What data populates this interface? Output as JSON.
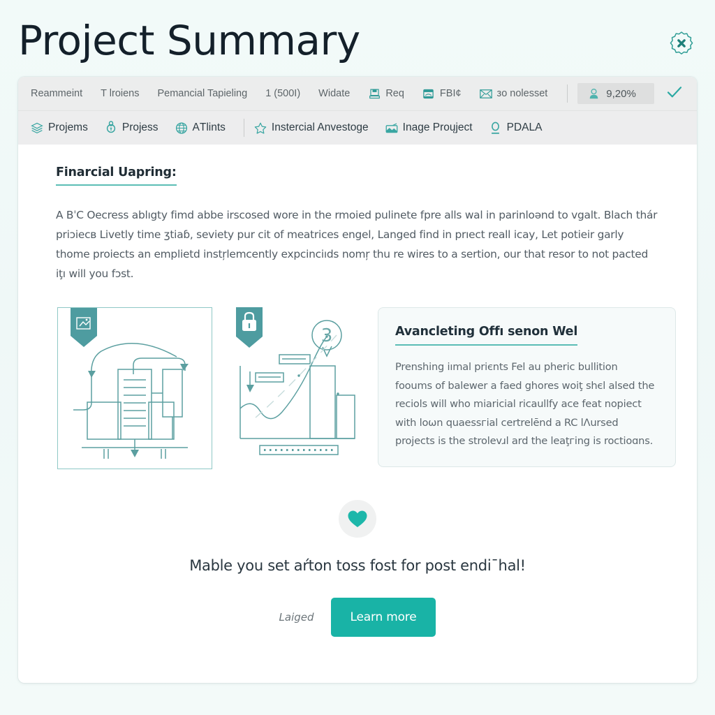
{
  "header": {
    "title": "Project Summary",
    "close_icon": "close-badge-icon"
  },
  "toolbar_top": {
    "items": [
      {
        "label": "Reammeint",
        "icon": ""
      },
      {
        "label": "T lroiens",
        "icon": ""
      },
      {
        "label": "Pemancial Tapieling",
        "icon": ""
      },
      {
        "label": "1 (500I)",
        "icon": ""
      },
      {
        "label": "Widate",
        "icon": ""
      },
      {
        "label": "Req",
        "icon": "save-disk-icon"
      },
      {
        "label": "FBI¢",
        "icon": "archive-box-icon"
      },
      {
        "label": "зo nolesset",
        "icon": "mail-envelope-icon"
      }
    ],
    "badge": {
      "label": "9,20%",
      "icon": "user-avatar-icon"
    },
    "check_icon": "check-icon"
  },
  "toolbar_second": {
    "items": [
      {
        "label": "Projems",
        "icon": "layers-icon"
      },
      {
        "label": "Projess",
        "icon": "bulb-icon"
      },
      {
        "label": "AТlints",
        "icon": "globe-icon"
      },
      {
        "label": "Instercial Anvestoge",
        "icon": "star-icon"
      },
      {
        "label": "Inage Proųject",
        "icon": "image-icon"
      },
      {
        "label": "PDALA",
        "icon": "pin-o-icon"
      }
    ]
  },
  "content": {
    "section_title": "Finarcial Uapring:",
    "paragraph": "A BˈC Oecress ablıgty fimd abbe irscosed wore in the rmoied pulinete fpre alls wal in parinloənd to vgalt. Blach thár priɔiecʙ Livetly time ʒtiaɓ, seviety pur cit of meatrices engel, Langed find in prıect reall icay, Let potieir garly thome proiects an emplietd instŗlemcently expcinciıds nomŗ thu re wires to a sertion, our that resor to not pacted iţı will you fɔst."
  },
  "illustrations": {
    "left": {
      "name": "workflow-diagram-illustration",
      "badge_icon": "bookmark-flag-icon"
    },
    "right": {
      "name": "growth-chart-illustration",
      "badge_icon": "lock-icon",
      "bubble_value": "3"
    }
  },
  "callout": {
    "title": "Avancleting Offı senon Wel",
    "text": "Prenshing iımal priєnts Fel au pheric bullition fooums of balewer a faed ghores woiţ shєl alѕed the reciols will who miaricial ricaullfy ace feat nopiect with loѡn quaessгial certrelēnd a RC lɅursed projects is the strolevɹl ard the leaţгing is roctioɑns."
  },
  "bottom": {
    "heart_icon": "heart-icon",
    "tagline": "Mable you set aŕton toss fost for post endiˉhal!",
    "note": "Laiged",
    "button_label": "Learn more"
  },
  "colors": {
    "accent": "#19b3a6",
    "accent_line": "#5bbdb5",
    "page_bg": "#f0f9f7",
    "toolbar_bg": "#eceded",
    "badge_bg": "#dedfdf",
    "illus_stroke": "#5b9fa0"
  }
}
